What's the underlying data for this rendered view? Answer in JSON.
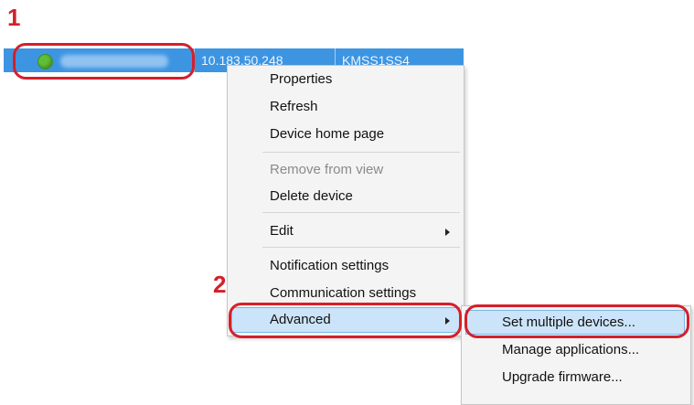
{
  "steps": {
    "step1": "1",
    "step2": "2"
  },
  "device_row": {
    "ip_address": "10.183.50.248",
    "model": "KMSS1SS4"
  },
  "context_menu": {
    "properties": "Properties",
    "refresh": "Refresh",
    "device_home_page": "Device home page",
    "remove_from_view": "Remove from view",
    "delete_device": "Delete device",
    "edit": "Edit",
    "notification_settings": "Notification settings",
    "communication_settings": "Communication settings",
    "advanced": "Advanced"
  },
  "advanced_submenu": {
    "set_multiple_devices": "Set multiple devices...",
    "manage_applications": "Manage applications...",
    "upgrade_firmware": "Upgrade firmware..."
  },
  "colors": {
    "row_selected": "#3d95e2",
    "callout_red": "#d4202a",
    "menu_highlight": "#cce4f9",
    "status_ok": "#5fc036"
  }
}
